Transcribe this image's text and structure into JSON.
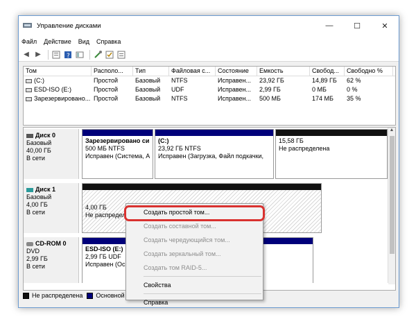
{
  "window": {
    "title": "Управление дисками",
    "minimize": "—",
    "maximize": "☐",
    "close": "✕"
  },
  "menu": [
    "Файл",
    "Действие",
    "Вид",
    "Справка"
  ],
  "toolbar": {
    "icons": [
      "back-icon",
      "forward-icon",
      "properties-icon",
      "help-icon",
      "refresh-icon",
      "connect-icon",
      "check-icon",
      "list-icon"
    ]
  },
  "volumes": {
    "headers": [
      "Том",
      "Располо...",
      "Тип",
      "Файловая с...",
      "Состояние",
      "Емкость",
      "Свобод...",
      "Свободно %"
    ],
    "rows": [
      [
        "(C:)",
        "Простой",
        "Базовый",
        "NTFS",
        "Исправен...",
        "23,92 ГБ",
        "14,89 ГБ",
        "62 %"
      ],
      [
        "ESD-ISO (E:)",
        "Простой",
        "Базовый",
        "UDF",
        "Исправен...",
        "2,99 ГБ",
        "0 МБ",
        "0 %"
      ],
      [
        "Зарезервировано...",
        "Простой",
        "Базовый",
        "NTFS",
        "Исправен...",
        "500 МБ",
        "174 МБ",
        "35 %"
      ]
    ]
  },
  "disks": [
    {
      "name": "Диск 0",
      "type": "Базовый",
      "size": "40,00 ГБ",
      "status": "В сети",
      "partitions": [
        {
          "title": "Зарезервировано си",
          "line1": "500 МБ NTFS",
          "line2": "Исправен (Система, А"
        },
        {
          "title": "(C:)",
          "line1": "23,92 ГБ NTFS",
          "line2": "Исправен (Загрузка, Файл подкачки,"
        },
        {
          "title": "",
          "line1": "15,58 ГБ",
          "line2": "Не распределена"
        }
      ]
    },
    {
      "name": "Диск 1",
      "type": "Базовый",
      "size": "4,00 ГБ",
      "status": "В сети",
      "partitions": [
        {
          "title": "",
          "line1": "4,00 ГБ",
          "line2": "Не распредел"
        }
      ]
    },
    {
      "name": "CD-ROM 0",
      "type": "DVD",
      "size": "2,99 ГБ",
      "status": "В сети",
      "partitions": [
        {
          "title": "ESD-ISO  (E:)",
          "line1": "2,99 ГБ UDF",
          "line2": "Исправен (Осн"
        }
      ]
    }
  ],
  "legend": [
    {
      "label": "Не распределена",
      "color": "#111111"
    },
    {
      "label": "Основной",
      "color": "#00007a"
    }
  ],
  "context_menu": {
    "items": [
      {
        "label": "Создать простой том...",
        "enabled": true
      },
      {
        "label": "Создать составной том...",
        "enabled": false
      },
      {
        "label": "Создать чередующийся том...",
        "enabled": false
      },
      {
        "label": "Создать зеркальный том...",
        "enabled": false
      },
      {
        "label": "Создать том RAID-5...",
        "enabled": false
      },
      {
        "label": "Свойства",
        "enabled": true
      },
      {
        "label": "Справка",
        "enabled": true
      }
    ]
  },
  "colors": {
    "primary_partition": "#00007a",
    "unallocated": "#111111",
    "highlight": "#d9312f"
  }
}
